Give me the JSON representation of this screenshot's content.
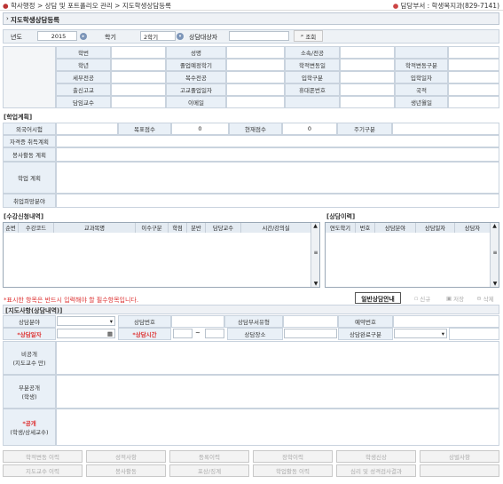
{
  "breadcrumb": {
    "items": [
      "학사행정",
      "상담 및 포트폴리오 관리",
      "지도학생상담등록"
    ],
    "sep": ">"
  },
  "dept": "담당부서 : 학생복지과(829-7141)",
  "page_title": "지도학생상담등록",
  "search": {
    "year_label": "년도",
    "year_value": "2015",
    "term_label": "학기",
    "term_value": "2학기",
    "target_label": "상담대상자",
    "target_value": "",
    "search_btn": "조회"
  },
  "student": {
    "row1": [
      "학번",
      "",
      "성명",
      "",
      "소속/전공",
      "",
      "",
      ""
    ],
    "row2": [
      "학년",
      "",
      "졸업예정학기",
      "",
      "학적변동일",
      "",
      "학적변동구분",
      ""
    ],
    "row3": [
      "세부전공",
      "",
      "복수전공",
      "",
      "입학구분",
      "",
      "입학일자",
      ""
    ],
    "row4": [
      "출신고교",
      "",
      "고교졸업일자",
      "",
      "휴대폰번호",
      "",
      "국적",
      ""
    ],
    "row5": [
      "담임교수",
      "",
      "이메일",
      "",
      "",
      "",
      "생년월일",
      ""
    ]
  },
  "plan": {
    "section": "[학업계획]",
    "foreign_label": "외국어시험",
    "foreign_value": "",
    "target_score_label": "목표점수",
    "target_score_value": "0",
    "current_score_label": "현재점수",
    "current_score_value": "0",
    "cycle_label": "주기구분",
    "cycle_value": "",
    "cert_label": "자격증 취득계획",
    "volunteer_label": "봉사활동 계획",
    "study_label": "학업 계획",
    "career_label": "취업희망분야"
  },
  "courses": {
    "section": "[수강신청내역]",
    "headers": [
      "순번",
      "수강코드",
      "교과목명",
      "이수구분",
      "학점",
      "분반",
      "담당교수",
      "시간/강의실"
    ]
  },
  "history": {
    "section": "[상담이력]",
    "headers": [
      "연도학기",
      "번호",
      "상담분야",
      "상담일자",
      "상담자"
    ]
  },
  "notice": "*표시한 항목은 반드시 입력해야 할 필수항목입니다.",
  "actions": {
    "guide": "일반상담안내",
    "new": "신규",
    "save": "저장",
    "delete": "삭제"
  },
  "consult": {
    "section": "[지도사항(상담내역)]",
    "field_label": "상담분야",
    "no_label": "상담번호",
    "type_label": "상담부서유형",
    "reserve_label": "예약번호",
    "date_label": "*상담일자",
    "time_label": "*상담시간",
    "time_sep": "~",
    "place_label": "상담장소",
    "done_label": "상담완료구분",
    "private_label": "비공개",
    "private_sub": "(지도교수 만)",
    "partial_label": "부분공개",
    "partial_sub": "(학생)",
    "public_label": "*공개",
    "public_sub": "(학생/상세교수)"
  },
  "bottom_buttons": {
    "row1": [
      "학적변동 이력",
      "성적사항",
      "등록이력",
      "장학이력",
      "학생신상",
      "상벌사항"
    ],
    "row2": [
      "지도교수 이력",
      "봉사활동",
      "포상/징계",
      "학업활동 이력",
      "심리 및 성격검사결과",
      ""
    ]
  }
}
